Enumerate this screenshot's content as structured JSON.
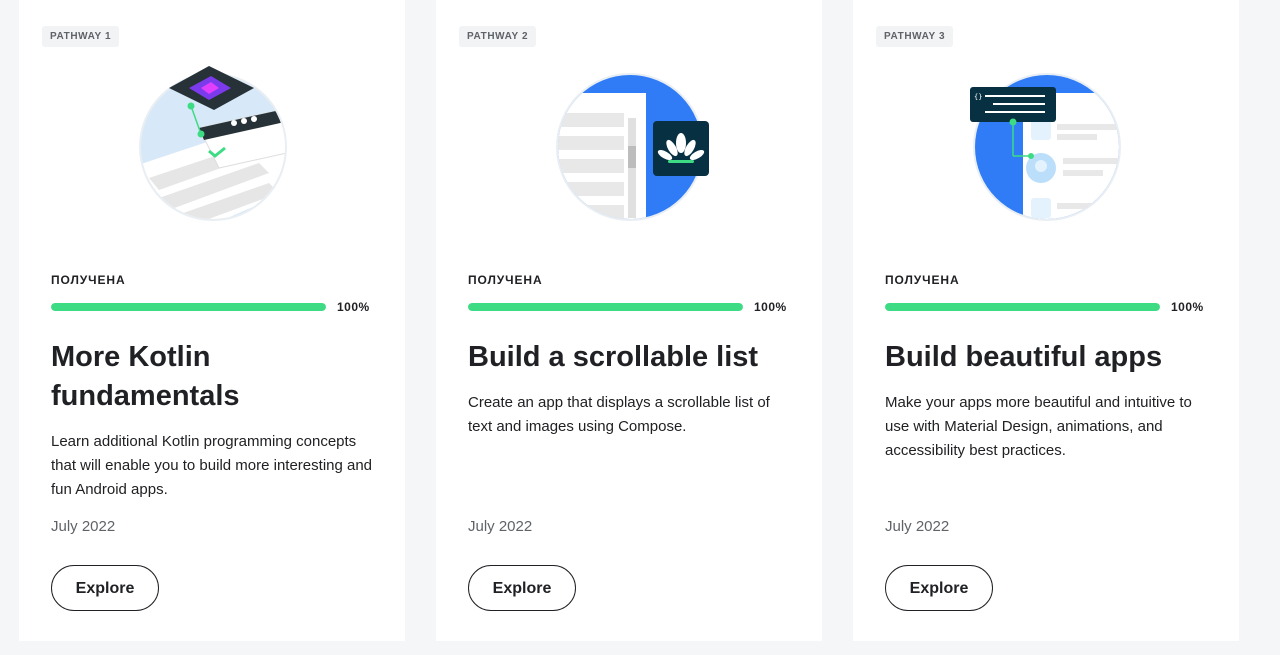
{
  "cards": [
    {
      "chip": "PATHWAY 1",
      "illustration": "kotlin-fundamentals-illustration",
      "status": "ПОЛУЧЕНА",
      "progress": 1.0,
      "progress_label": "100%",
      "title": "More Kotlin fundamentals",
      "description": "Learn additional Kotlin programming concepts that will enable you to build more interesting and fun Android apps.",
      "date": "July 2022",
      "button": "Explore"
    },
    {
      "chip": "PATHWAY 2",
      "illustration": "scrollable-list-illustration",
      "status": "ПОЛУЧЕНА",
      "progress": 1.0,
      "progress_label": "100%",
      "title": "Build a scrollable list",
      "description": "Create an app that displays a scrollable list of text and images using Compose.",
      "date": "July 2022",
      "button": "Explore"
    },
    {
      "chip": "PATHWAY 3",
      "illustration": "beautiful-apps-illustration",
      "status": "ПОЛУЧЕНА",
      "progress": 1.0,
      "progress_label": "100%",
      "title": "Build beautiful apps",
      "description": "Make your apps more beautiful and intuitive to use with Material Design, animations, and accessibility best practices.",
      "date": "July 2022",
      "button": "Explore"
    }
  ],
  "colors": {
    "progress_fill": "#3ddc84",
    "progress_track": "#e8eaed",
    "accent_blue": "#2f7cf6",
    "dark_teal": "#073042"
  }
}
